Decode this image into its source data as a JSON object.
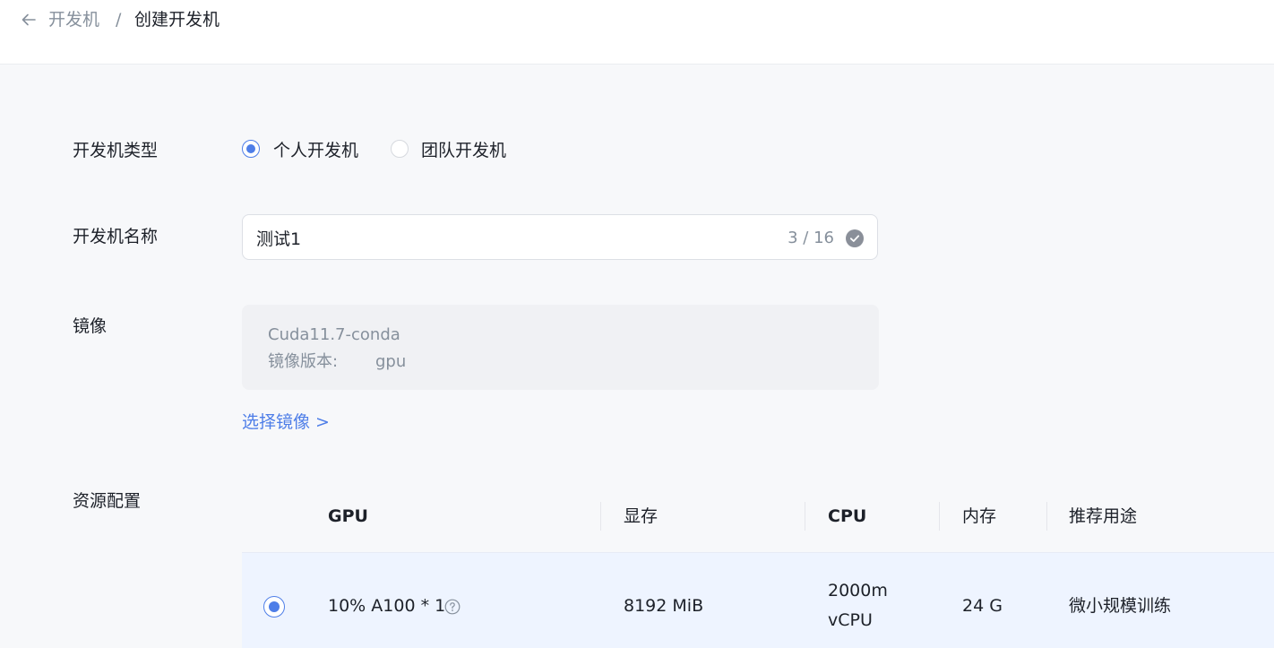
{
  "breadcrumb": {
    "back_icon": "arrow-left-icon",
    "parent": "开发机",
    "separator": "/",
    "current": "创建开发机"
  },
  "form": {
    "type": {
      "label": "开发机类型",
      "options": [
        {
          "label": "个人开发机",
          "checked": true
        },
        {
          "label": "团队开发机",
          "checked": false
        }
      ]
    },
    "name": {
      "label": "开发机名称",
      "value": "测试1",
      "counter": "3 / 16",
      "status_icon": "check-circle-icon"
    },
    "image": {
      "label": "镜像",
      "name": "Cuda11.7-conda",
      "version_label": "镜像版本:",
      "version_value": "gpu",
      "select_link": "选择镜像 >"
    },
    "resource": {
      "label": "资源配置",
      "columns": [
        "GPU",
        "显存",
        "CPU",
        "内存",
        "推荐用途"
      ],
      "rows": [
        {
          "selected": true,
          "gpu": "10% A100 * 1",
          "gpu_help_icon": "question-circle-icon",
          "memory": "8192 MiB",
          "cpu_line1": "2000m",
          "cpu_line2": "vCPU",
          "ram": "24 G",
          "usage": "微小规模训练"
        }
      ]
    }
  },
  "colors": {
    "accent": "#4e7ee8",
    "page_background": "#f7f8fa",
    "selected_row": "#eef4ff"
  }
}
